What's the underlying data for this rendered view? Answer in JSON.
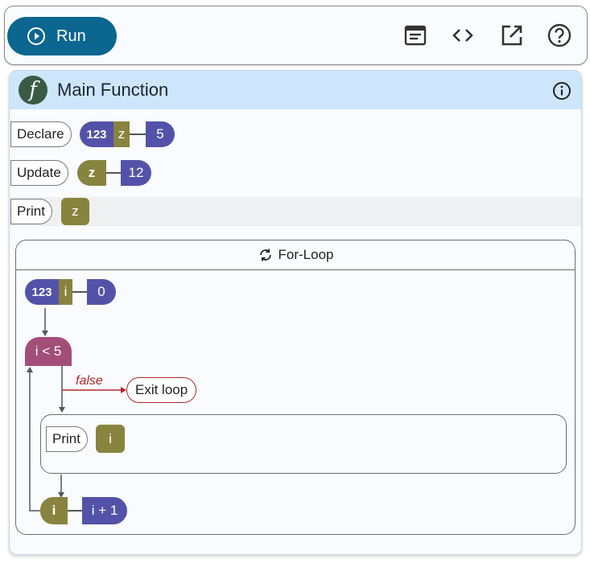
{
  "toolbar": {
    "run_label": "Run",
    "icons": [
      "document-icon",
      "code-icon",
      "open-external-icon",
      "help-icon"
    ]
  },
  "panel": {
    "title": "Main Function",
    "fn_symbol": "f"
  },
  "statements": {
    "declare": {
      "keyword": "Declare",
      "type": "123",
      "var": "z",
      "value": "5"
    },
    "update": {
      "keyword": "Update",
      "var": "z",
      "value": "12"
    },
    "print": {
      "keyword": "Print",
      "var": "z"
    }
  },
  "loop": {
    "title": "For-Loop",
    "init_type": "123",
    "init_var": "i",
    "init_value": "0",
    "condition": "i < 5",
    "false_label": "false",
    "exit_label": "Exit loop",
    "body_keyword": "Print",
    "body_var": "i",
    "step_var": "i",
    "step_value": "i + 1"
  },
  "colors": {
    "run_button": "#0b6690",
    "header_bg": "#cde6fb",
    "number_pill": "#5452a8",
    "variable_pill": "#88843f",
    "condition_pill": "#a34e79",
    "false_branch": "#b02a2a"
  }
}
